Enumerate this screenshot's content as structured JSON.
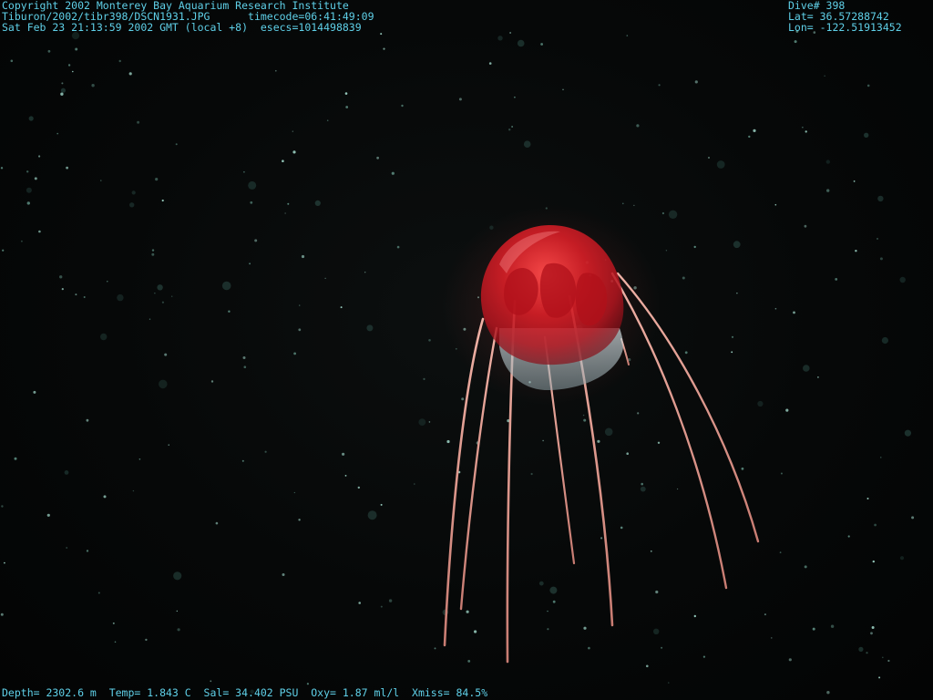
{
  "overlay": {
    "top_left": {
      "copyright": "Copyright 2002 Monterey Bay Aquarium Research Institute",
      "file_line": "Tiburon/2002/tibr398/DSCN1931.JPG      timecode=06:41:49:09",
      "date_line": "Sat Feb 23 21:13:59 2002 GMT (local +8)  esecs=1014498839"
    },
    "top_right": {
      "dive": "Dive# 398",
      "lat": "Lat= 36.57288742",
      "lon": "Lon= -122.51913452"
    },
    "bottom": {
      "sensors": "Depth= 2302.6 m  Temp= 1.843 C  Sal= 34.402 PSU  Oxy= 1.87 ml/l  Xmiss= 84.5%"
    }
  },
  "colors": {
    "overlay_text": "#5fd0e8",
    "background": "#050606",
    "bell_red": "#d8202a",
    "bell_pale": "#b9c6c8",
    "tentacle": "#e8a59a"
  },
  "subject": {
    "icon": "jellyfish-icon"
  }
}
